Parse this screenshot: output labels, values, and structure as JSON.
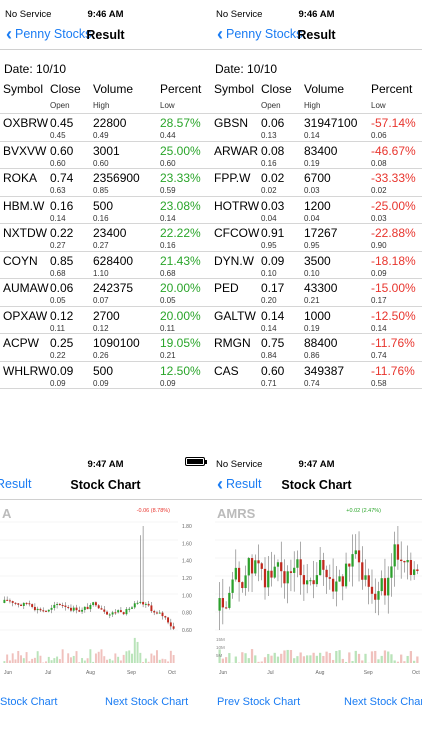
{
  "status": {
    "carrier": "No Service",
    "time_result": "9:46 AM",
    "time_chart": "9:47 AM"
  },
  "nav": {
    "back_penny": "Penny Stocks",
    "result_title": "Result",
    "back_result": "Result",
    "chart_title": "Stock Chart"
  },
  "table": {
    "date": "Date: 10/10",
    "headers": {
      "symbol": "Symbol",
      "close": "Close",
      "volume": "Volume",
      "percent": "Percent",
      "open": "Open",
      "high": "High",
      "low": "Low"
    }
  },
  "gainers": [
    {
      "symbol": "OXBRW",
      "close": "0.45",
      "volume": "22800",
      "percent": "28.57%",
      "open": "0.45",
      "high": "0.49",
      "low": "0.44"
    },
    {
      "symbol": "BVXVW",
      "close": "0.60",
      "volume": "3001",
      "percent": "25.00%",
      "open": "0.60",
      "high": "0.60",
      "low": "0.60"
    },
    {
      "symbol": "ROKA",
      "close": "0.74",
      "volume": "2356900",
      "percent": "23.33%",
      "open": "0.63",
      "high": "0.85",
      "low": "0.59"
    },
    {
      "symbol": "HBM.W",
      "close": "0.16",
      "volume": "500",
      "percent": "23.08%",
      "open": "0.14",
      "high": "0.16",
      "low": "0.14"
    },
    {
      "symbol": "NXTDW",
      "close": "0.22",
      "volume": "23400",
      "percent": "22.22%",
      "open": "0.27",
      "high": "0.27",
      "low": "0.16"
    },
    {
      "symbol": "COYN",
      "close": "0.85",
      "volume": "628400",
      "percent": "21.43%",
      "open": "0.68",
      "high": "1.10",
      "low": "0.68"
    },
    {
      "symbol": "AUMAW",
      "close": "0.06",
      "volume": "242375",
      "percent": "20.00%",
      "open": "0.05",
      "high": "0.07",
      "low": "0.05"
    },
    {
      "symbol": "OPXAW",
      "close": "0.12",
      "volume": "2700",
      "percent": "20.00%",
      "open": "0.11",
      "high": "0.12",
      "low": "0.11"
    },
    {
      "symbol": "ACPW",
      "close": "0.25",
      "volume": "1090100",
      "percent": "19.05%",
      "open": "0.22",
      "high": "0.26",
      "low": "0.21"
    },
    {
      "symbol": "WHLRW",
      "close": "0.09",
      "volume": "500",
      "percent": "12.50%",
      "open": "0.09",
      "high": "0.09",
      "low": "0.09"
    }
  ],
  "losers": [
    {
      "symbol": "GBSN",
      "close": "0.06",
      "volume": "31947100",
      "percent": "-57.14%",
      "open": "0.13",
      "high": "0.14",
      "low": "0.06"
    },
    {
      "symbol": "ARWAR",
      "close": "0.08",
      "volume": "83400",
      "percent": "-46.67%",
      "open": "0.16",
      "high": "0.19",
      "low": "0.08"
    },
    {
      "symbol": "FPP.W",
      "close": "0.02",
      "volume": "6700",
      "percent": "-33.33%",
      "open": "0.02",
      "high": "0.03",
      "low": "0.02"
    },
    {
      "symbol": "HOTRW",
      "close": "0.03",
      "volume": "1200",
      "percent": "-25.00%",
      "open": "0.04",
      "high": "0.04",
      "low": "0.03"
    },
    {
      "symbol": "CFCOW",
      "close": "0.91",
      "volume": "17267",
      "percent": "-22.88%",
      "open": "0.95",
      "high": "0.95",
      "low": "0.90"
    },
    {
      "symbol": "DYN.W",
      "close": "0.09",
      "volume": "3500",
      "percent": "-18.18%",
      "open": "0.10",
      "high": "0.10",
      "low": "0.09"
    },
    {
      "symbol": "PED",
      "close": "0.17",
      "volume": "43300",
      "percent": "-15.00%",
      "open": "0.20",
      "high": "0.21",
      "low": "0.17"
    },
    {
      "symbol": "GALTW",
      "close": "0.14",
      "volume": "1000",
      "percent": "-12.50%",
      "open": "0.14",
      "high": "0.19",
      "low": "0.14"
    },
    {
      "symbol": "RMGN",
      "close": "0.75",
      "volume": "88400",
      "percent": "-11.76%",
      "open": "0.84",
      "high": "0.86",
      "low": "0.74"
    },
    {
      "symbol": "CAS",
      "close": "0.60",
      "volume": "349387",
      "percent": "-11.76%",
      "open": "0.71",
      "high": "0.74",
      "low": "0.58"
    }
  ],
  "chart_left": {
    "ticker": "A",
    "change_label": "-0.06 (8.78%)",
    "x_ticks": [
      "Jun",
      "Jul",
      "Aug",
      "Sep",
      "Oct"
    ],
    "price_ticks": [
      "1.80",
      "1.60",
      "1.40",
      "1.20",
      "1.00",
      "0.80",
      "0.60"
    ],
    "prev_link": "Stock Chart",
    "next_link": "Next Stock Chart"
  },
  "chart_right": {
    "ticker": "AMRS",
    "change_label": "+0.02 (2.47%)",
    "x_ticks": [
      "Jun",
      "Jul",
      "Aug",
      "Sep",
      "Oct"
    ],
    "volume_ticks": [
      "15M",
      "10M",
      "5M"
    ],
    "prev_link": "Prev Stock Chart",
    "next_link": "Next Stock Char"
  },
  "colors": {
    "accent": "#1a7cf3",
    "gain": "#2aa52a",
    "loss": "#e8352e",
    "candle_up": "#2ca02c",
    "candle_down": "#c0281d"
  }
}
